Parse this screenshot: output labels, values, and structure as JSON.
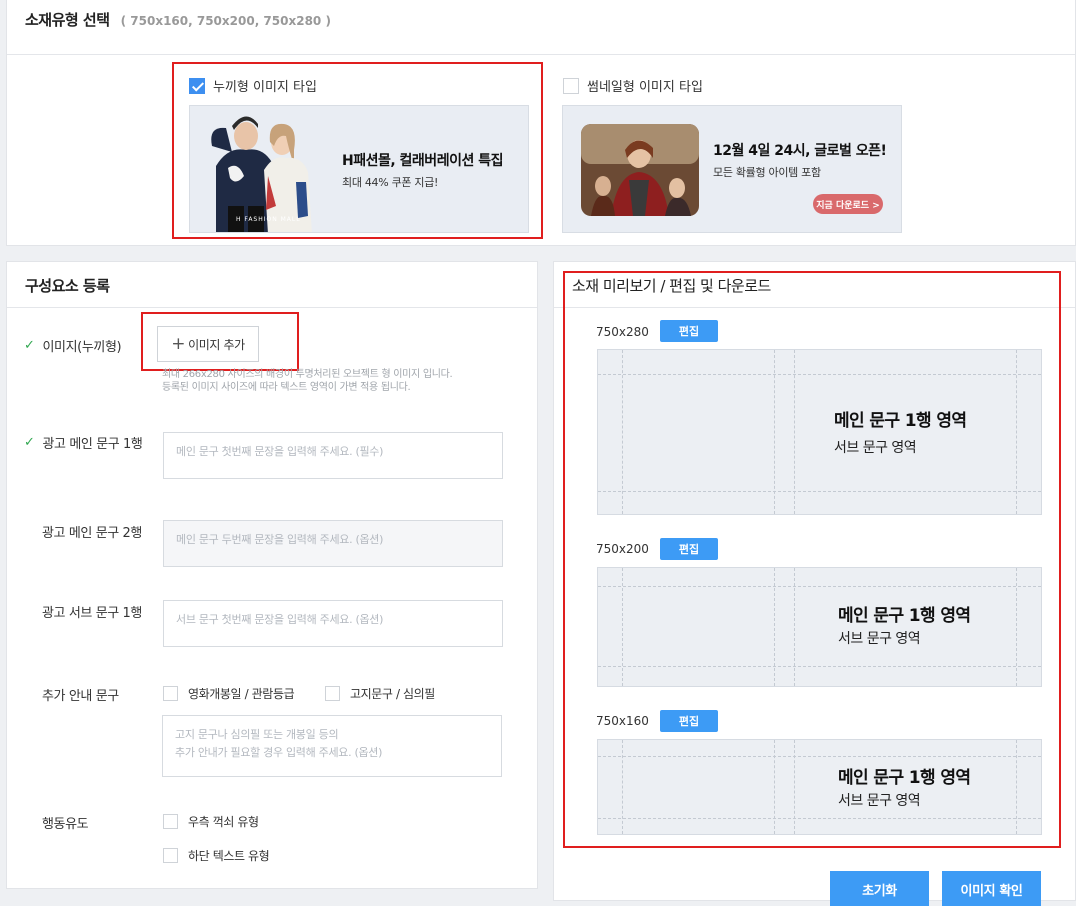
{
  "top": {
    "title": "소재유형 선택",
    "subtitle": "( 750x160, 750x200, 750x280 )",
    "options": [
      {
        "label": "누끼형 이미지 타입",
        "checked": true,
        "headline": "H패션몰, 컬래버레이션 특집",
        "subline": "최대 44% 쿠폰 지급!",
        "logo_text": "H FASHION MALL"
      },
      {
        "label": "썸네일형 이미지 타입",
        "checked": false,
        "headline": "12월 4일 24시, 글로벌 오픈!",
        "subline": "모든 확률형 아이템 포함",
        "cta": "지금 다운로드 >"
      }
    ]
  },
  "components": {
    "title": "구성요소 등록",
    "image": {
      "label": "이미지(누끼형)",
      "add_button": "이미지 추가",
      "help_line1": "최대 266x280 사이즈의 배경이 투명처리된 오브젝트 형 이미지 입니다.",
      "help_line2": "등록된 이미지 사이즈에 따라 텍스트 영역이 가변 적용 됩니다."
    },
    "main1": {
      "label": "광고 메인 문구 1행",
      "placeholder": "메인 문구 첫번째 문장을 입력해 주세요. (필수)"
    },
    "main2": {
      "label": "광고 메인 문구 2행",
      "placeholder": "메인 문구 두번째 문장을 입력해 주세요. (옵션)"
    },
    "sub1": {
      "label": "광고 서브 문구 1행",
      "placeholder": "서브 문구 첫번째 문장을 입력해 주세요. (옵션)"
    },
    "extra": {
      "label": "추가 안내 문구",
      "option1": "영화개봉일 / 관람등급",
      "option2": "고지문구 / 심의필",
      "placeholder_line1": "고지 문구나 심의필 또는 개봉일 등의",
      "placeholder_line2": "추가 안내가 필요할 경우 입력해 주세요. (옵션)"
    },
    "action": {
      "label": "행동유도",
      "option1": "우측 꺽쇠 유형",
      "option2": "하단 텍스트 유형"
    }
  },
  "preview": {
    "title": "소재 미리보기 / 편집 및 다운로드",
    "edit_label": "편집",
    "main_text": "메인 문구 1행 영역",
    "sub_text": "서브 문구 영역",
    "sizes": [
      "750x280",
      "750x200",
      "750x160"
    ]
  },
  "buttons": {
    "reset": "초기화",
    "confirm": "이미지 확인"
  },
  "colors": {
    "accent": "#3d9bf5",
    "highlight": "#e01e1e",
    "check": "#32a852"
  }
}
